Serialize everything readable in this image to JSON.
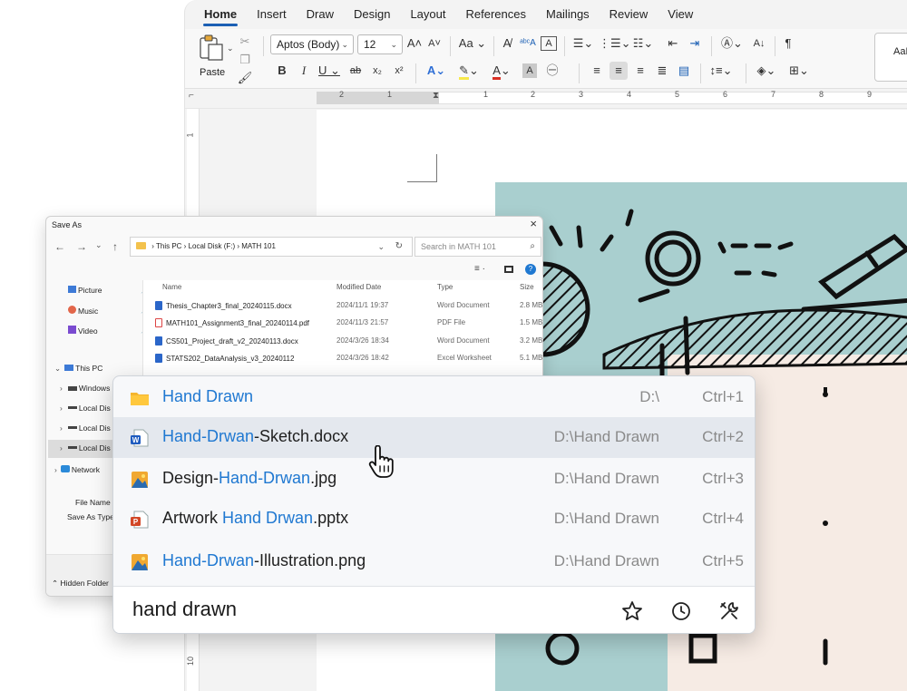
{
  "word": {
    "tabs": [
      "Home",
      "Insert",
      "Draw",
      "Design",
      "Layout",
      "References",
      "Mailings",
      "Review",
      "View"
    ],
    "paste_label": "Paste",
    "font_name": "Aptos (Body)",
    "font_size": "12",
    "style_preview": "AaB",
    "ruler_numbers": [
      "2",
      "1",
      "1",
      "2",
      "3",
      "4",
      "5",
      "6",
      "7",
      "8",
      "9"
    ],
    "vruler_numbers": [
      "1",
      "10"
    ]
  },
  "save_as": {
    "title": "Save As",
    "breadcrumb": [
      "This PC",
      "Local Disk (F:)",
      "MATH 101"
    ],
    "search_placeholder": "Search in MATH 101",
    "quick_access": [
      {
        "label": "Picture",
        "icon": "picture-icon"
      },
      {
        "label": "Music",
        "icon": "music-icon"
      },
      {
        "label": "Video",
        "icon": "video-icon"
      }
    ],
    "tree": [
      {
        "label": "This PC",
        "icon": "pc-icon"
      },
      {
        "label": "Windows",
        "icon": "drive-icon"
      },
      {
        "label": "Local Dis",
        "icon": "drive-icon"
      },
      {
        "label": "Local Dis",
        "icon": "drive-icon"
      },
      {
        "label": "Local Dis",
        "icon": "drive-icon"
      },
      {
        "label": "Network",
        "icon": "network-icon"
      }
    ],
    "columns": [
      "Name",
      "Modified Date",
      "Type",
      "Size"
    ],
    "files": [
      {
        "name": "Thesis_Chapter3_final_20240115.docx",
        "date": "2024/11/1 19:37",
        "type": "Word Document",
        "size": "2.8 MB",
        "kind": "word"
      },
      {
        "name": "MATH101_Assignment3_final_20240114.pdf",
        "date": "2024/11/3 21:57",
        "type": "PDF File",
        "size": "1.5 MB",
        "kind": "pdf"
      },
      {
        "name": "CS501_Project_draft_v2_20240113.docx",
        "date": "2024/3/26 18:34",
        "type": "Word Document",
        "size": "3.2 MB",
        "kind": "word"
      },
      {
        "name": "STATS202_DataAnalysis_v3_20240112",
        "date": "2024/3/26 18:42",
        "type": "Excel Worksheet",
        "size": "5.1 MB",
        "kind": "excel"
      }
    ],
    "file_name_label": "File Name (",
    "save_as_type_label": "Save As Type",
    "hidden_folder_label": "Hidden Folder"
  },
  "launcher": {
    "results": [
      {
        "pre": "",
        "match": "Hand Drawn",
        "post": "",
        "path": "D:\\",
        "shortcut": "Ctrl+1",
        "icon": "folder-icon"
      },
      {
        "pre": "",
        "match": "Hand-Drwan",
        "post": "-Sketch.docx",
        "path": "D:\\Hand Drawn",
        "shortcut": "Ctrl+2",
        "icon": "word-file-icon"
      },
      {
        "pre": "Design-",
        "match": "Hand-Drwan",
        "post": ".jpg",
        "path": "D:\\Hand Drawn",
        "shortcut": "Ctrl+3",
        "icon": "image-file-icon"
      },
      {
        "pre": "Artwork ",
        "match": "Hand Drwan",
        "post": ".pptx",
        "path": "D:\\Hand Drawn",
        "shortcut": "Ctrl+4",
        "icon": "powerpoint-file-icon"
      },
      {
        "pre": "",
        "match": "Hand-Drwan",
        "post": "-Illustration.png",
        "path": "D:\\Hand Drawn",
        "shortcut": "Ctrl+5",
        "icon": "image-file-icon"
      }
    ],
    "query": "hand drawn",
    "highlighted_index": 1,
    "accent_color": "#1f78d1"
  }
}
